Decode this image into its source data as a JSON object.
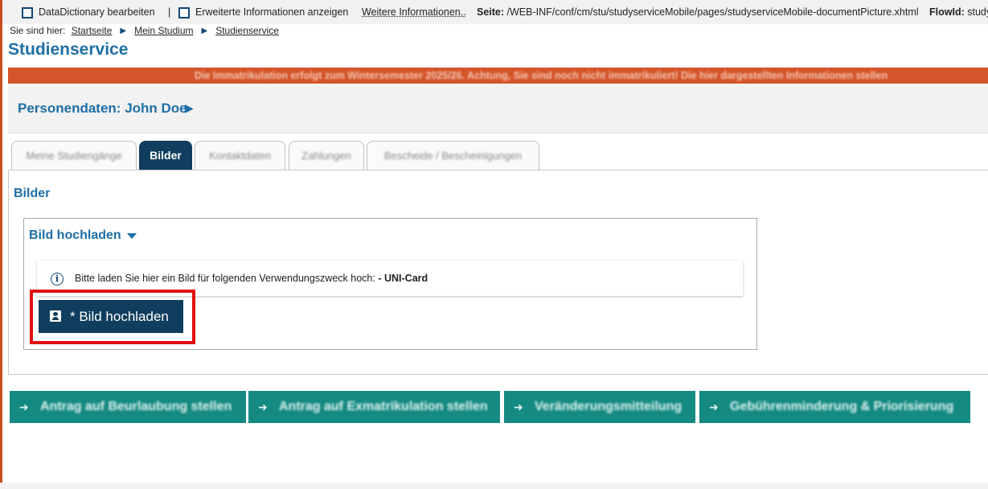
{
  "debug_bar": {
    "datadictionary_label": "DataDictionary bearbeiten",
    "separator": "|",
    "extended_info_label": "Erweiterte Informationen anzeigen",
    "more_info_link": "Weitere Informationen..",
    "page_label": "Seite:",
    "page_path": "/WEB-INF/conf/cm/stu/studyserviceMobile/pages/studyserviceMobile-documentPicture.xhtml",
    "flowid_label": "FlowId:",
    "flowid_value": "study"
  },
  "breadcrumb": {
    "prefix": "Sie sind hier:",
    "items": [
      "Startseite",
      "Mein Studium",
      "Studienservice"
    ]
  },
  "page_title": "Studienservice",
  "banner_text": "Die Immatrikulation erfolgt zum Wintersemester 2025/26. Achtung, Sie sind noch nicht immatrikuliert! Die hier dargestellten Informationen stellen",
  "person": {
    "label": "Personendaten: John Doe"
  },
  "tabs": [
    {
      "label": "Meine Studiengänge",
      "active": false
    },
    {
      "label": "Bilder",
      "active": true
    },
    {
      "label": "Kontaktdaten",
      "active": false
    },
    {
      "label": "Zahlungen",
      "active": false
    },
    {
      "label": "Bescheide / Bescheinigungen",
      "active": false
    }
  ],
  "section_title": "Bilder",
  "upload_panel": {
    "title": "Bild hochladen",
    "info_prefix": "Bitte laden Sie hier ein Bild für folgenden Verwendungszweck hoch:",
    "info_value": "- UNI-Card",
    "button_label": "* Bild hochladen"
  },
  "actions": [
    "Antrag auf Beurlaubung stellen",
    "Antrag auf Exmatrikulation stellen",
    "Veränderungsmitteilung",
    "Gebührenminderung & Priorisierung"
  ],
  "colors": {
    "accent": "#1e6fa6",
    "dark_blue": "#0f3e5e",
    "banner": "#d4552a",
    "teal": "#158a82",
    "highlight": "#e01010"
  }
}
